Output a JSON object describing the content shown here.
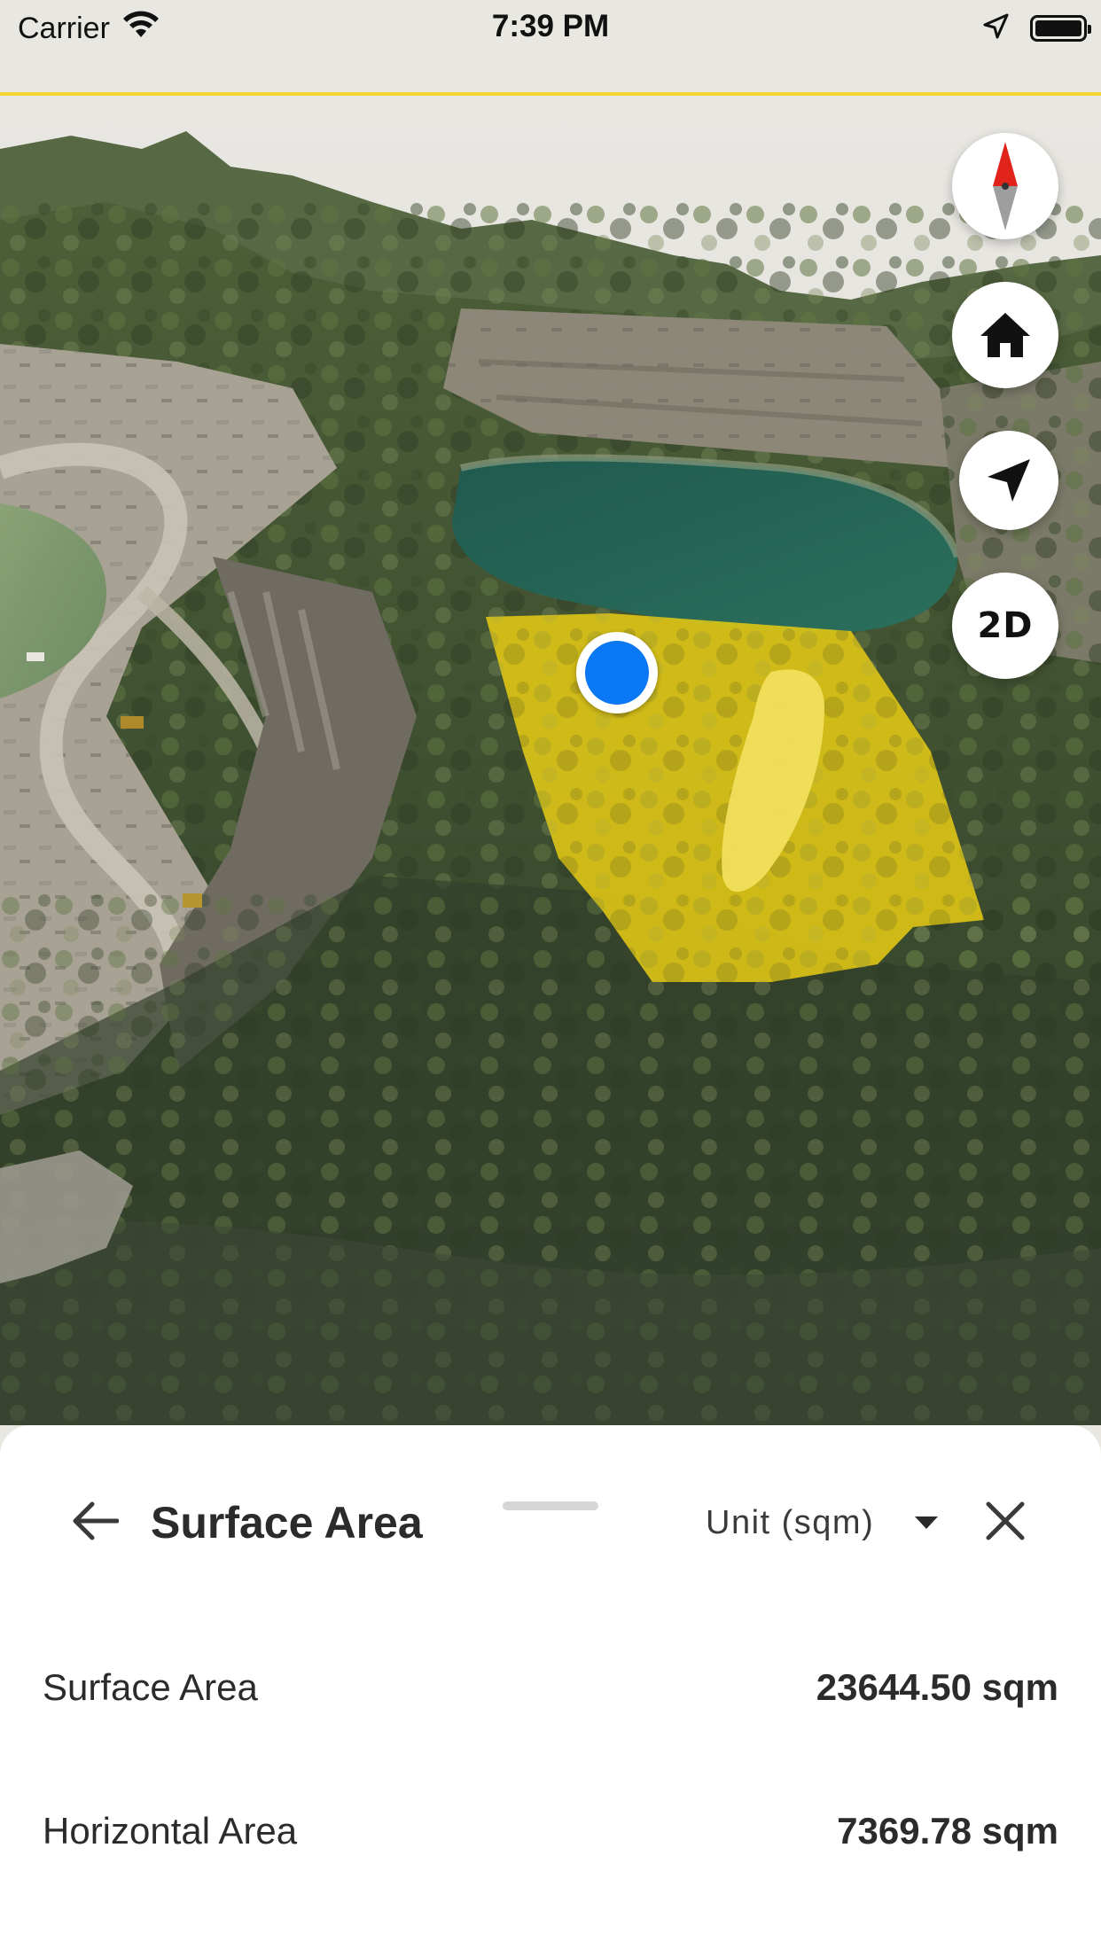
{
  "status_bar": {
    "carrier": "Carrier",
    "time": "7:39 PM",
    "icons": [
      "wifi-icon",
      "location-arrow-icon",
      "battery-icon"
    ]
  },
  "map": {
    "controls": [
      {
        "name": "compass-button",
        "icon": "compass-icon"
      },
      {
        "name": "home-button",
        "icon": "home-icon"
      },
      {
        "name": "locate-button",
        "icon": "navigation-arrow-icon"
      },
      {
        "name": "view-mode-button",
        "label": "2D"
      }
    ],
    "colors": {
      "highlight_polygon": "#e2c814",
      "location_dot": "#0a78f5",
      "compass_north": "#e0231b"
    }
  },
  "sheet": {
    "title": "Surface Area",
    "unit_label": "Unit (sqm)",
    "rows": [
      {
        "label": "Surface Area",
        "value": "23644.50 sqm"
      },
      {
        "label": "Horizontal Area",
        "value": "7369.78 sqm"
      }
    ]
  }
}
